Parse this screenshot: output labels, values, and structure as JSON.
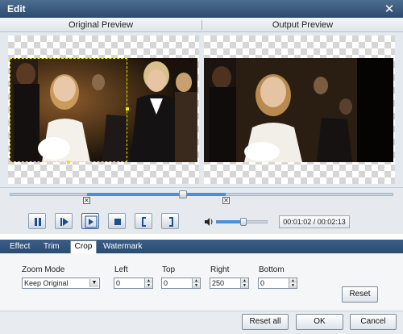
{
  "window": {
    "title": "Edit",
    "close_glyph": "✕"
  },
  "preview": {
    "original_label": "Original Preview",
    "output_label": "Output Preview"
  },
  "playback": {
    "time_current": "00:01:02",
    "time_total": "00:02:13",
    "time_display": "00:01:02 / 00:02:13",
    "volume_level": 0.5,
    "trim_start_marker": "✕",
    "trim_end_marker": "✕"
  },
  "tabs": [
    {
      "label": "Effect",
      "active": false
    },
    {
      "label": "Trim",
      "active": false
    },
    {
      "label": "Crop",
      "active": true
    },
    {
      "label": "Watermark",
      "active": false
    }
  ],
  "crop": {
    "zoom_mode_label": "Zoom Mode",
    "zoom_mode_value": "Keep Original",
    "left_label": "Left",
    "left_value": "0",
    "top_label": "Top",
    "top_value": "0",
    "right_label": "Right",
    "right_value": "250",
    "bottom_label": "Bottom",
    "bottom_value": "0",
    "reset_label": "Reset"
  },
  "footer": {
    "reset_all_label": "Reset all",
    "ok_label": "OK",
    "cancel_label": "Cancel"
  },
  "colors": {
    "titlebar": "#2c4a6e",
    "accent": "#4a90d9",
    "crop_frame": "#e8e800"
  }
}
